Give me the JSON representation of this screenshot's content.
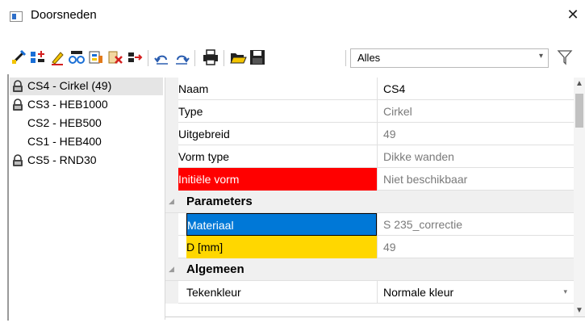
{
  "window": {
    "title": "Doorsneden",
    "close_label": "✕"
  },
  "toolbar": {
    "buttons": [
      "new-icon",
      "insert-icon",
      "edit-icon",
      "copy-icon",
      "library-icon",
      "delete-icon",
      "import-icon",
      "undo-icon",
      "redo-icon",
      "print-icon",
      "open-icon",
      "save-icon"
    ],
    "filter_value": "Alles",
    "filter_arrow": "▾"
  },
  "tree": {
    "items": [
      {
        "label": "CS4 - Cirkel (49)",
        "locked": true,
        "selected": true
      },
      {
        "label": "CS3 - HEB1000",
        "locked": true,
        "selected": false
      },
      {
        "label": "CS2 - HEB500",
        "locked": false,
        "selected": false
      },
      {
        "label": "CS1 - HEB400",
        "locked": false,
        "selected": false
      },
      {
        "label": "CS5 - RND30",
        "locked": true,
        "selected": false
      }
    ]
  },
  "properties": {
    "rows": [
      {
        "name": "Naam",
        "value": "CS4",
        "style": "normal",
        "value_style": "dark"
      },
      {
        "name": "Type",
        "value": "Cirkel",
        "style": "normal",
        "value_style": "gray"
      },
      {
        "name": "Uitgebreid",
        "value": "49",
        "style": "normal",
        "value_style": "gray"
      },
      {
        "name": "Vorm type",
        "value": "Dikke wanden",
        "style": "normal",
        "value_style": "gray"
      },
      {
        "name": "Initiële vorm",
        "value": "Niet beschikbaar",
        "style": "red",
        "value_style": "gray"
      }
    ],
    "categories": {
      "parameters": {
        "label": "Parameters",
        "rows": [
          {
            "name": "Materiaal",
            "value": "S 235_correctie",
            "style": "blue",
            "value_style": "gray"
          },
          {
            "name": "D [mm]",
            "value": "49",
            "style": "yellow",
            "value_style": "gray"
          }
        ]
      },
      "algemeen": {
        "label": "Algemeen",
        "rows": [
          {
            "name": "Tekenkleur",
            "value": "Normale kleur",
            "style": "normal",
            "value_style": "dark"
          }
        ]
      }
    }
  },
  "colors": {
    "error_red": "#ff0000",
    "selection_blue": "#0078d7",
    "highlight_yellow": "#ffd700"
  }
}
